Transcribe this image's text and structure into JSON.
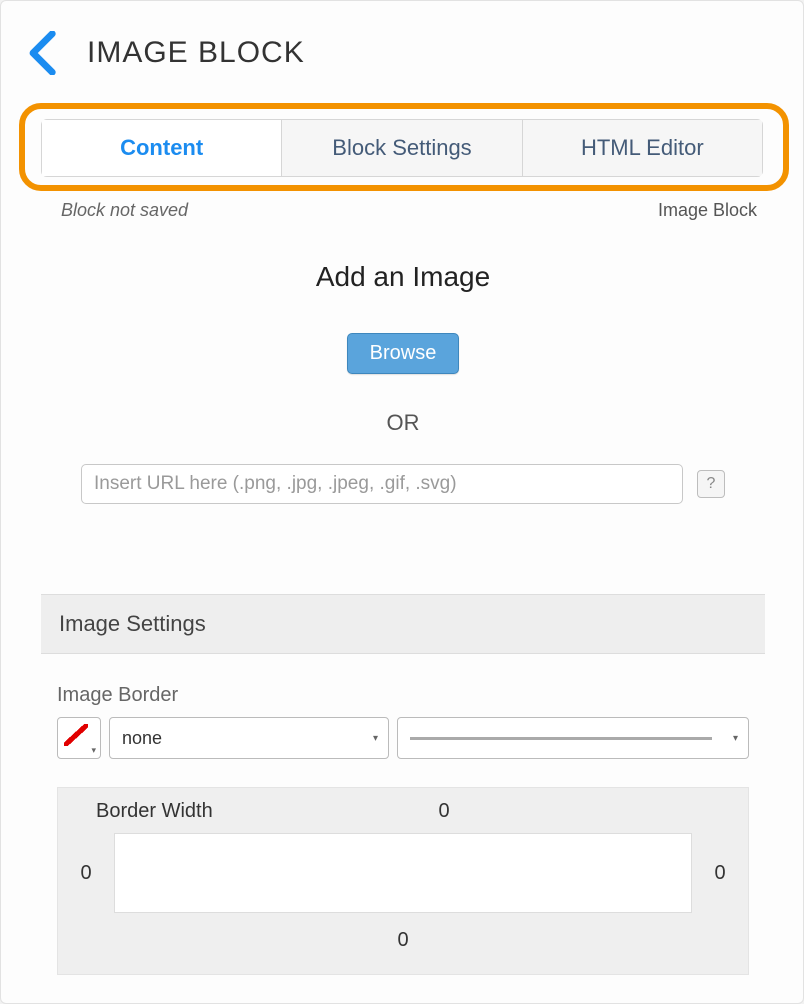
{
  "header": {
    "title": "IMAGE BLOCK"
  },
  "tabs": [
    {
      "label": "Content",
      "active": true
    },
    {
      "label": "Block Settings",
      "active": false
    },
    {
      "label": "HTML Editor",
      "active": false
    }
  ],
  "meta": {
    "left": "Block not saved",
    "right": "Image Block"
  },
  "addImage": {
    "heading": "Add an Image",
    "browse": "Browse",
    "or": "OR",
    "urlPlaceholder": "Insert URL here (.png, .jpg, .jpeg, .gif, .svg)",
    "help": "?"
  },
  "imageSettings": {
    "sectionTitle": "Image Settings",
    "borderLabel": "Image Border",
    "borderStyle": "none",
    "widthTitle": "Border Width",
    "top": "0",
    "left": "0",
    "right": "0",
    "bottom": "0"
  }
}
